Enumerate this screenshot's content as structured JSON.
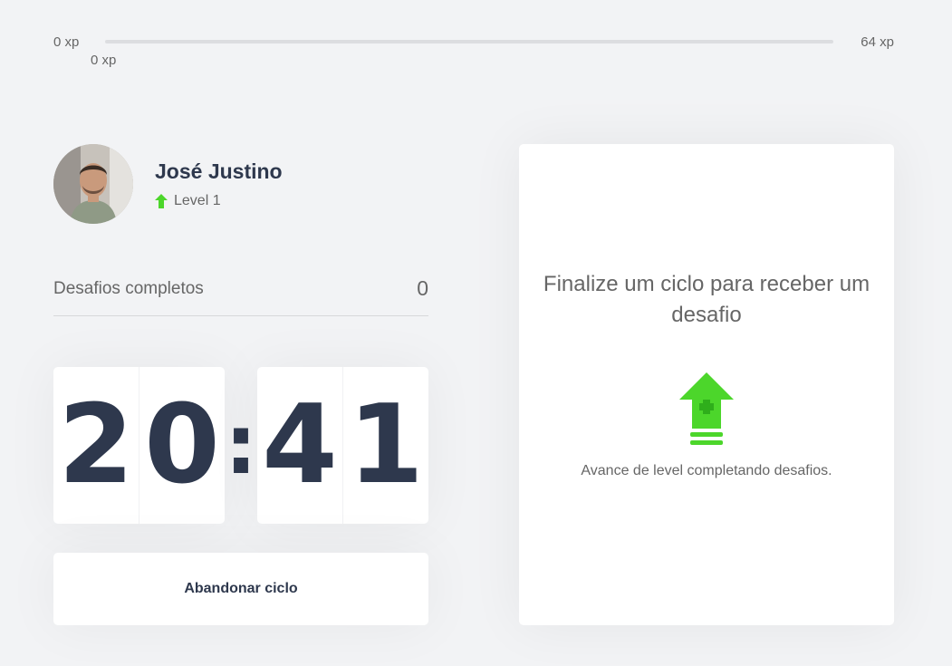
{
  "experience": {
    "min_label": "0 xp",
    "max_label": "64 xp",
    "current_label": "0 xp",
    "progress_fraction": 0.0
  },
  "profile": {
    "name": "José Justino",
    "level_label": "Level 1",
    "level_icon": "level-up-arrow-icon"
  },
  "challenges_completed": {
    "label": "Desafios completos",
    "count": "0"
  },
  "countdown": {
    "minute_left": "2",
    "minute_right": "0",
    "separator": ":",
    "second_left": "4",
    "second_right": "1"
  },
  "abandon_button_label": "Abandonar ciclo",
  "challenge_box": {
    "title": "Finalize um ciclo para receber um desafio",
    "hint": "Avance de level completando desafios.",
    "icon": "level-up-icon"
  },
  "colors": {
    "accent_green": "#4cd62b",
    "title_dark": "#2e384d",
    "text": "#666666",
    "background": "#f2f3f5"
  }
}
